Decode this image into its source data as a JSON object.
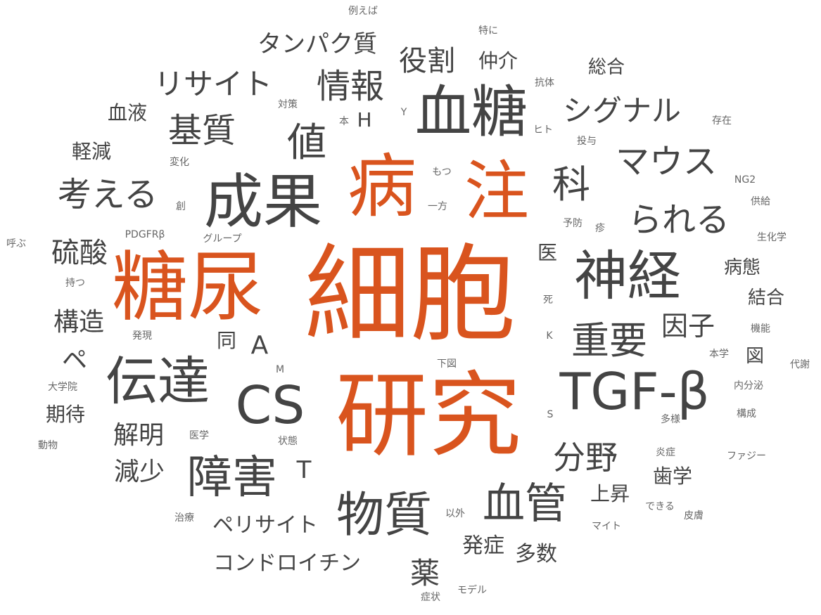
{
  "colors": {
    "accent": "#d9541e",
    "dark": "#444444",
    "mid": "#555555",
    "light": "#666666",
    "background": "#ffffff"
  },
  "words": [
    "細胞",
    "研究",
    "糖尿",
    "病",
    "注",
    "成果",
    "血糖",
    "神経",
    "TGF-β",
    "CS",
    "伝達",
    "物質",
    "障害",
    "血管",
    "重要",
    "科",
    "値",
    "マウス",
    "情報",
    "基質",
    "考える",
    "られる",
    "シグナル",
    "役割",
    "リサイト",
    "タンパク質",
    "分野",
    "因子",
    "薬",
    "硫酸",
    "構造",
    "解明",
    "減少",
    "コンドロイチン",
    "ペリサイト",
    "発症",
    "多数",
    "上昇",
    "歯学",
    "病態",
    "結合",
    "総合",
    "仲介",
    "血液",
    "軽減",
    "期待",
    "ペ",
    "A",
    "T",
    "H",
    "同",
    "医",
    "図",
    "例えば",
    "特に",
    "抗体",
    "存在",
    "ヒト",
    "投与",
    "対策",
    "本",
    "Y",
    "変化",
    "もつ",
    "創",
    "一方",
    "NG2",
    "供給",
    "予防",
    "疹",
    "生化学",
    "PDGFRβ",
    "グループ",
    "呼ぶ",
    "持つ",
    "死",
    "機能",
    "発現",
    "K",
    "本学",
    "代謝",
    "M",
    "下図",
    "大学院",
    "内分泌",
    "S",
    "構成",
    "多様",
    "動物",
    "医学",
    "状態",
    "炎症",
    "ファジー",
    "治療",
    "以外",
    "できる",
    "皮膚",
    "マイト",
    "モデル",
    "症状"
  ]
}
